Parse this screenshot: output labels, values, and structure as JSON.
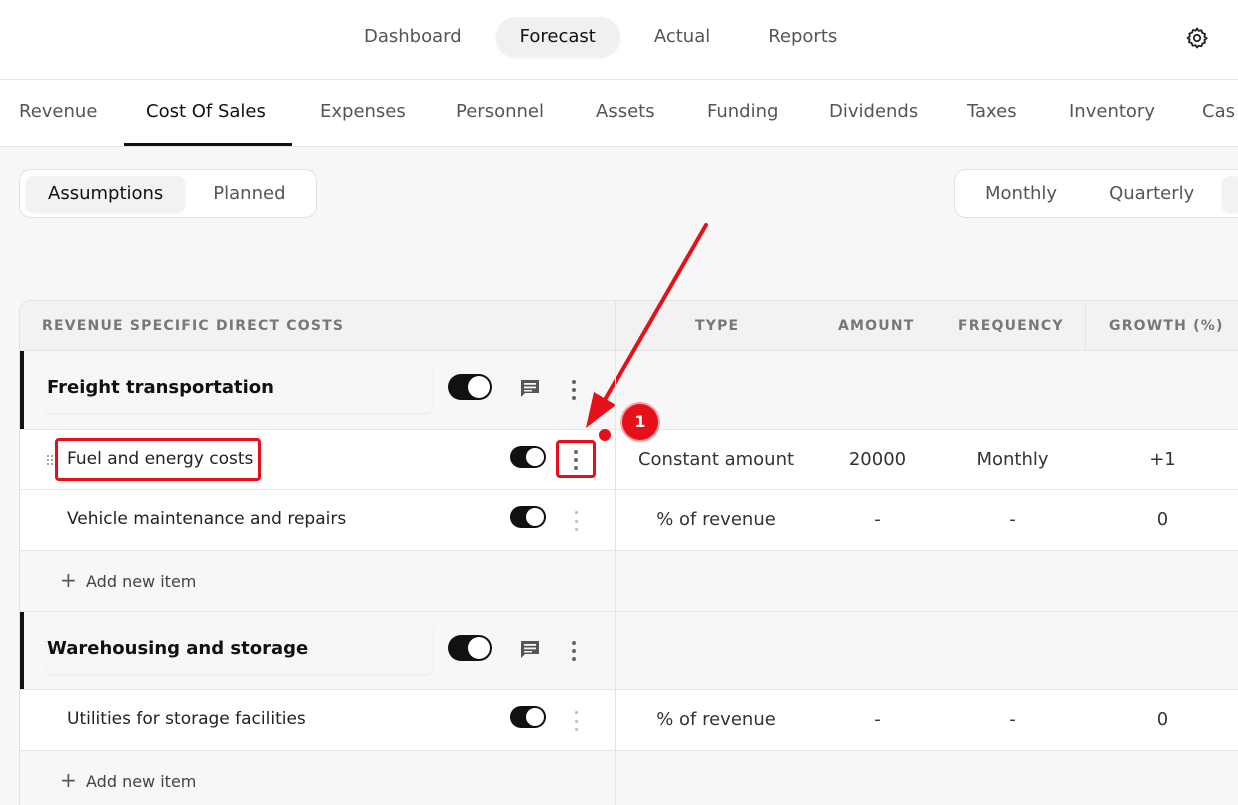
{
  "top_nav": {
    "items": [
      "Dashboard",
      "Forecast",
      "Actual",
      "Reports"
    ],
    "active": "Forecast"
  },
  "sub_tabs": {
    "items": [
      "Revenue",
      "Cost Of Sales",
      "Expenses",
      "Personnel",
      "Assets",
      "Funding",
      "Dividends",
      "Taxes",
      "Inventory",
      "Cas"
    ],
    "active": "Cost Of Sales"
  },
  "view_toggle": {
    "items": [
      "Assumptions",
      "Planned"
    ],
    "active": "Assumptions"
  },
  "period_toggle": {
    "items": [
      "Monthly",
      "Quarterly"
    ],
    "active": "Monthly"
  },
  "table": {
    "headers": {
      "name": "REVENUE SPECIFIC DIRECT COSTS",
      "type": "TYPE",
      "amount": "AMOUNT",
      "frequency": "FREQUENCY",
      "growth": "GROWTH (%)"
    },
    "groups": [
      {
        "title": "Freight transportation",
        "enabled": true,
        "items": [
          {
            "name": "Fuel and energy costs",
            "enabled": true,
            "type": "Constant amount",
            "amount": "20000",
            "frequency": "Monthly",
            "growth": "+1"
          },
          {
            "name": "Vehicle maintenance and repairs",
            "enabled": true,
            "type": "% of revenue",
            "amount": "-",
            "frequency": "-",
            "growth": "0"
          }
        ],
        "add_label": "Add new item"
      },
      {
        "title": "Warehousing and storage",
        "enabled": true,
        "items": [
          {
            "name": "Utilities for storage facilities",
            "enabled": true,
            "type": "% of revenue",
            "amount": "-",
            "frequency": "-",
            "growth": "0"
          }
        ],
        "add_label": "Add new item"
      }
    ]
  },
  "annotation": {
    "step_number": "1",
    "color": "#e6101a"
  },
  "icons": {
    "settings": "gear-icon",
    "comment": "comment-icon",
    "more": "more-vertical-icon",
    "drag": "drag-handle-icon",
    "add": "plus-icon"
  }
}
